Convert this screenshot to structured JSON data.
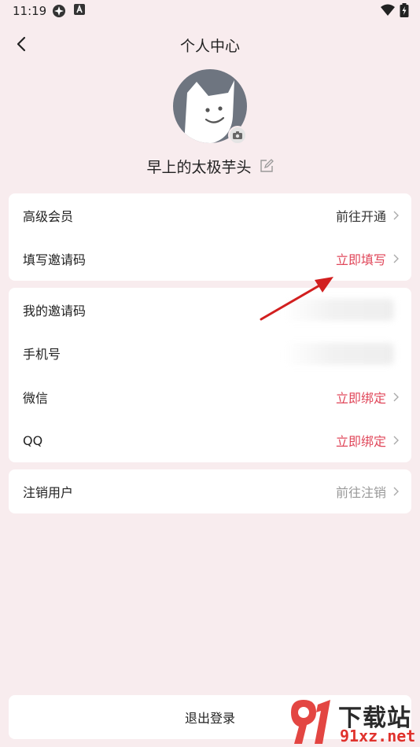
{
  "status_bar": {
    "time": "11:19"
  },
  "header": {
    "title": "个人中心"
  },
  "profile": {
    "username": "早上的太极芋头"
  },
  "card_membership": {
    "rows": [
      {
        "label": "高级会员",
        "value": "前往开通"
      },
      {
        "label": "填写邀请码",
        "value": "立即填写"
      }
    ]
  },
  "card_bindings": {
    "rows": [
      {
        "label": "我的邀请码",
        "value": ""
      },
      {
        "label": "手机号",
        "value": ""
      },
      {
        "label": "微信",
        "value": "立即绑定"
      },
      {
        "label": "QQ",
        "value": "立即绑定"
      }
    ]
  },
  "card_account": {
    "rows": [
      {
        "label": "注销用户",
        "value": "前往注销"
      }
    ]
  },
  "logout": {
    "label": "退出登录"
  },
  "watermark": {
    "brand_text": "下载站",
    "url_text": "91xz.net"
  },
  "colors": {
    "background": "#f8ecee",
    "accent_red": "#e0475a",
    "muted_gray": "#999999",
    "avatar_gray": "#6e7580"
  },
  "icons": {
    "back": "chevron-left-icon",
    "edit": "edit-icon",
    "camera": "camera-icon",
    "row_arrow": "chevron-right-icon"
  }
}
